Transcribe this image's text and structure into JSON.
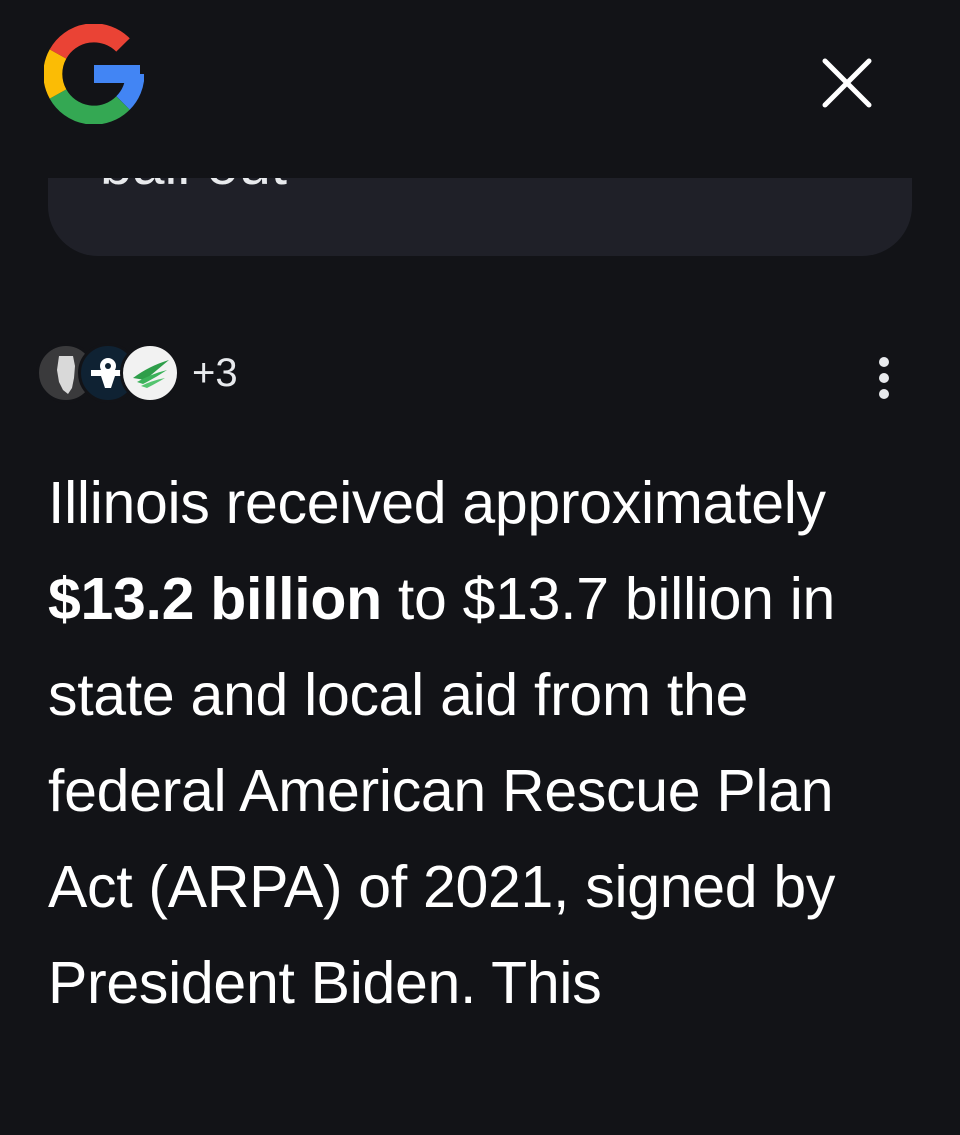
{
  "header": {
    "logo_icon": "google-g-icon",
    "close_icon": "close-icon"
  },
  "query": {
    "text": "bail out"
  },
  "sources": {
    "icons": [
      "illinois-state-icon",
      "eagle-seal-icon",
      "green-wings-icon"
    ],
    "more_count": "+3",
    "menu_icon": "more-vertical-icon"
  },
  "answer": {
    "part1": "Illinois received approximately ",
    "bold": "$13.2 billion",
    "part2": " to $13.7 billion in state and local aid from the federal American Rescue Plan Act (ARPA) of 2021, signed by President Biden. This"
  },
  "colors": {
    "background": "#121317",
    "card": "#1f2028",
    "text": "#ffffff"
  }
}
